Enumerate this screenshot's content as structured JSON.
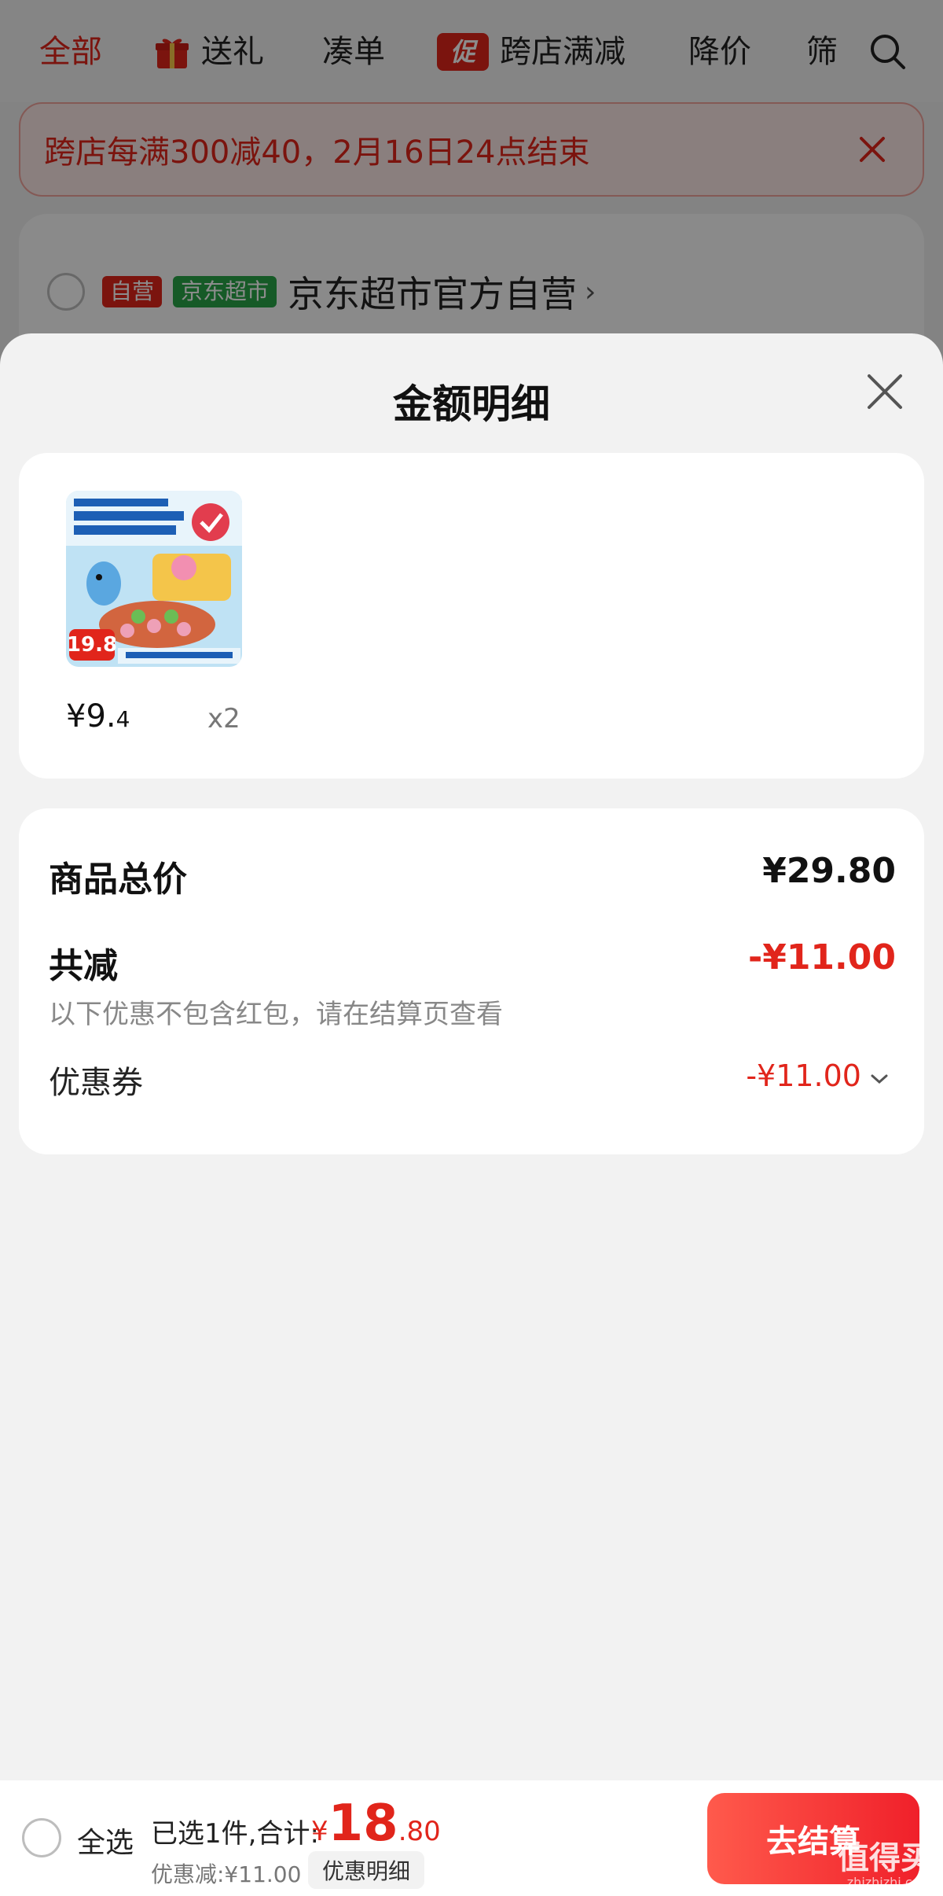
{
  "topnav": {
    "tabs": [
      {
        "label": "全部",
        "active": true
      },
      {
        "label": "送礼",
        "icon": "gift-icon"
      },
      {
        "label": "凑单"
      },
      {
        "label": "跨店满减",
        "tag": "促"
      },
      {
        "label": "降价"
      },
      {
        "label": "筛"
      }
    ]
  },
  "promo_banner": {
    "text": "跨店每满300减40，2月16日24点结束"
  },
  "shop": {
    "badge_self": "自营",
    "badge_market": "京东超市",
    "name": "京东超市官方自营",
    "arrow": "›"
  },
  "sheet": {
    "title": "金额明细",
    "product": {
      "image_badge": "19.8",
      "price_main": "¥9.",
      "price_small": "4",
      "quantity": "x2"
    },
    "summary": {
      "total_label": "商品总价",
      "total_value": "¥29.80",
      "reduce_label": "共减",
      "reduce_value": "-¥11.00",
      "note": "以下优惠不包含红包，请在结算页查看",
      "coupon_label": "优惠券",
      "coupon_value": "-¥11.00"
    }
  },
  "bottom_bar": {
    "select_all": "全选",
    "selected_text": "已选1件,合计:",
    "total_yen": "¥",
    "total_int": "18",
    "total_dec": ".80",
    "discount_text": "优惠减:¥11.00",
    "detail_button": "优惠明细",
    "checkout_button": "去结算"
  },
  "watermark": {
    "text": "值得买",
    "sub": "zhizhizhi.com"
  },
  "colors": {
    "accent": "#e1251b",
    "market_green": "#28a548",
    "sheet_bg": "#f2f2f2"
  }
}
